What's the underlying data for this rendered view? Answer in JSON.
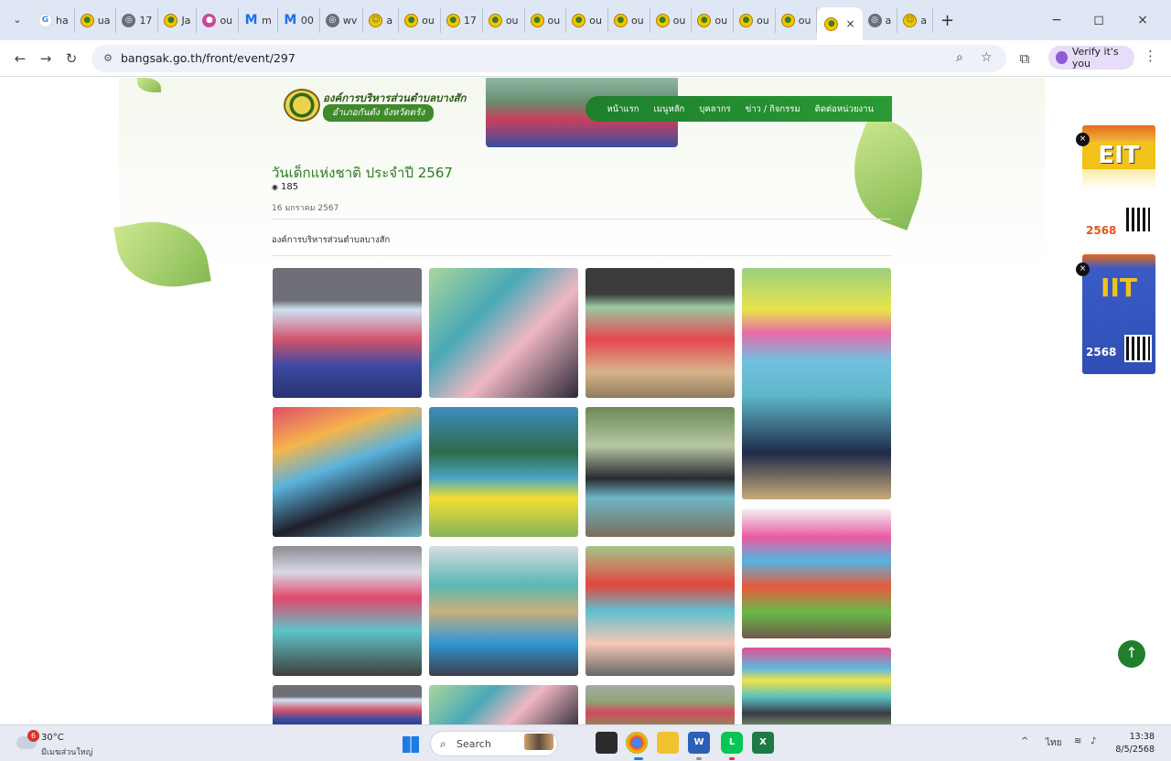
{
  "browser": {
    "tabs": [
      {
        "icon": "google-icon",
        "label": "ha"
      },
      {
        "icon": "site-logo-icon",
        "label": "ua"
      },
      {
        "icon": "globe-icon",
        "label": "17"
      },
      {
        "icon": "site-logo-icon",
        "label": "Ja"
      },
      {
        "icon": "pink-logo-icon",
        "label": "ou"
      },
      {
        "icon": "gmail-icon",
        "label": "m"
      },
      {
        "icon": "gmail-icon",
        "label": "00"
      },
      {
        "icon": "globe-icon",
        "label": "wv"
      },
      {
        "icon": "emoji-icon",
        "label": "a"
      },
      {
        "icon": "site-logo-icon",
        "label": "ou"
      },
      {
        "icon": "site-logo-icon",
        "label": "17"
      },
      {
        "icon": "site-logo-icon",
        "label": "ou"
      },
      {
        "icon": "site-logo-icon",
        "label": "ou"
      },
      {
        "icon": "site-logo-icon",
        "label": "ou"
      },
      {
        "icon": "site-logo-icon",
        "label": "ou"
      },
      {
        "icon": "site-logo-icon",
        "label": "ou"
      },
      {
        "icon": "site-logo-icon",
        "label": "ou"
      },
      {
        "icon": "site-logo-icon",
        "label": "ou"
      },
      {
        "icon": "site-logo-icon",
        "label": "ou"
      }
    ],
    "active_tab_close": "×",
    "tabs_after": [
      {
        "icon": "globe-icon",
        "label": "a"
      },
      {
        "icon": "emoji-icon",
        "label": "a"
      }
    ],
    "new_tab": "+",
    "url": "bangsak.go.th/front/event/297",
    "verify_label": "Verify it's you",
    "window_controls": [
      "−",
      "◻",
      "×"
    ]
  },
  "site": {
    "org_name": "องค์การบริหารส่วนตำบลบางสัก",
    "org_sub": "อำเภอกันตัง จังหวัดตรัง",
    "menu": [
      "หน้าแรก",
      "เมนูหลัก",
      "บุคลากร",
      "ข่าว / กิจกรรม",
      "ติดต่อหน่วยงาน"
    ]
  },
  "event": {
    "title": "วันเด็กแห่งชาติ ประจำปี 2567",
    "views": "185",
    "date": "16 มกราคม 2567",
    "org": "องค์การบริหารส่วนตำบลบางสัก"
  },
  "ads": {
    "eit": {
      "tag": "อบต.บางสัก",
      "big": "EIT",
      "year": "2568",
      "qr_label": "สแกน Qr Code"
    },
    "iit": {
      "tag": "อบต.บางสัก",
      "big": "IIT",
      "year": "2568",
      "qr_label": "สแกน Qr Code"
    }
  },
  "taskbar": {
    "weather_badge": "6",
    "temperature": "30°C",
    "weather_desc": "มีเมฆส่วนใหญ่",
    "search_label": "Search",
    "lang": "ไทย",
    "time": "13:38",
    "date": "8/5/2568"
  }
}
